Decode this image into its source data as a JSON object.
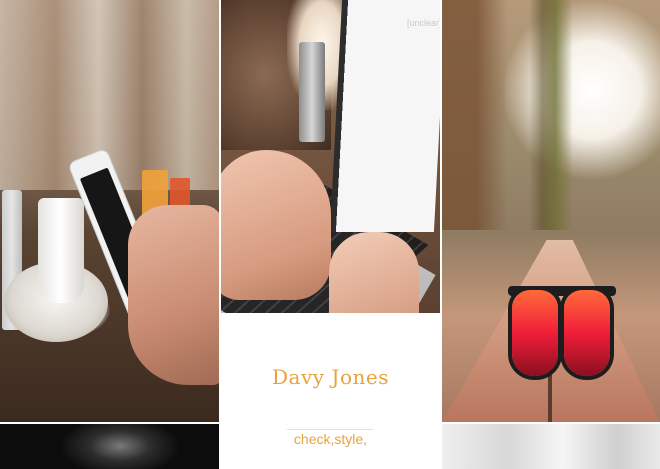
{
  "gallery": {
    "tiles": [
      {
        "subject": "phone-in-cafe"
      },
      {
        "subject": "laptop-typing",
        "screen_text": "[unclear]"
      },
      {
        "subject": "sunglasses-on-bench"
      }
    ],
    "caption": {
      "title": "Davy Jones",
      "tags": "check,style,"
    }
  },
  "colors": {
    "accent": "#e8a33d",
    "divider": "#e2e2e2",
    "background": "#ffffff"
  }
}
